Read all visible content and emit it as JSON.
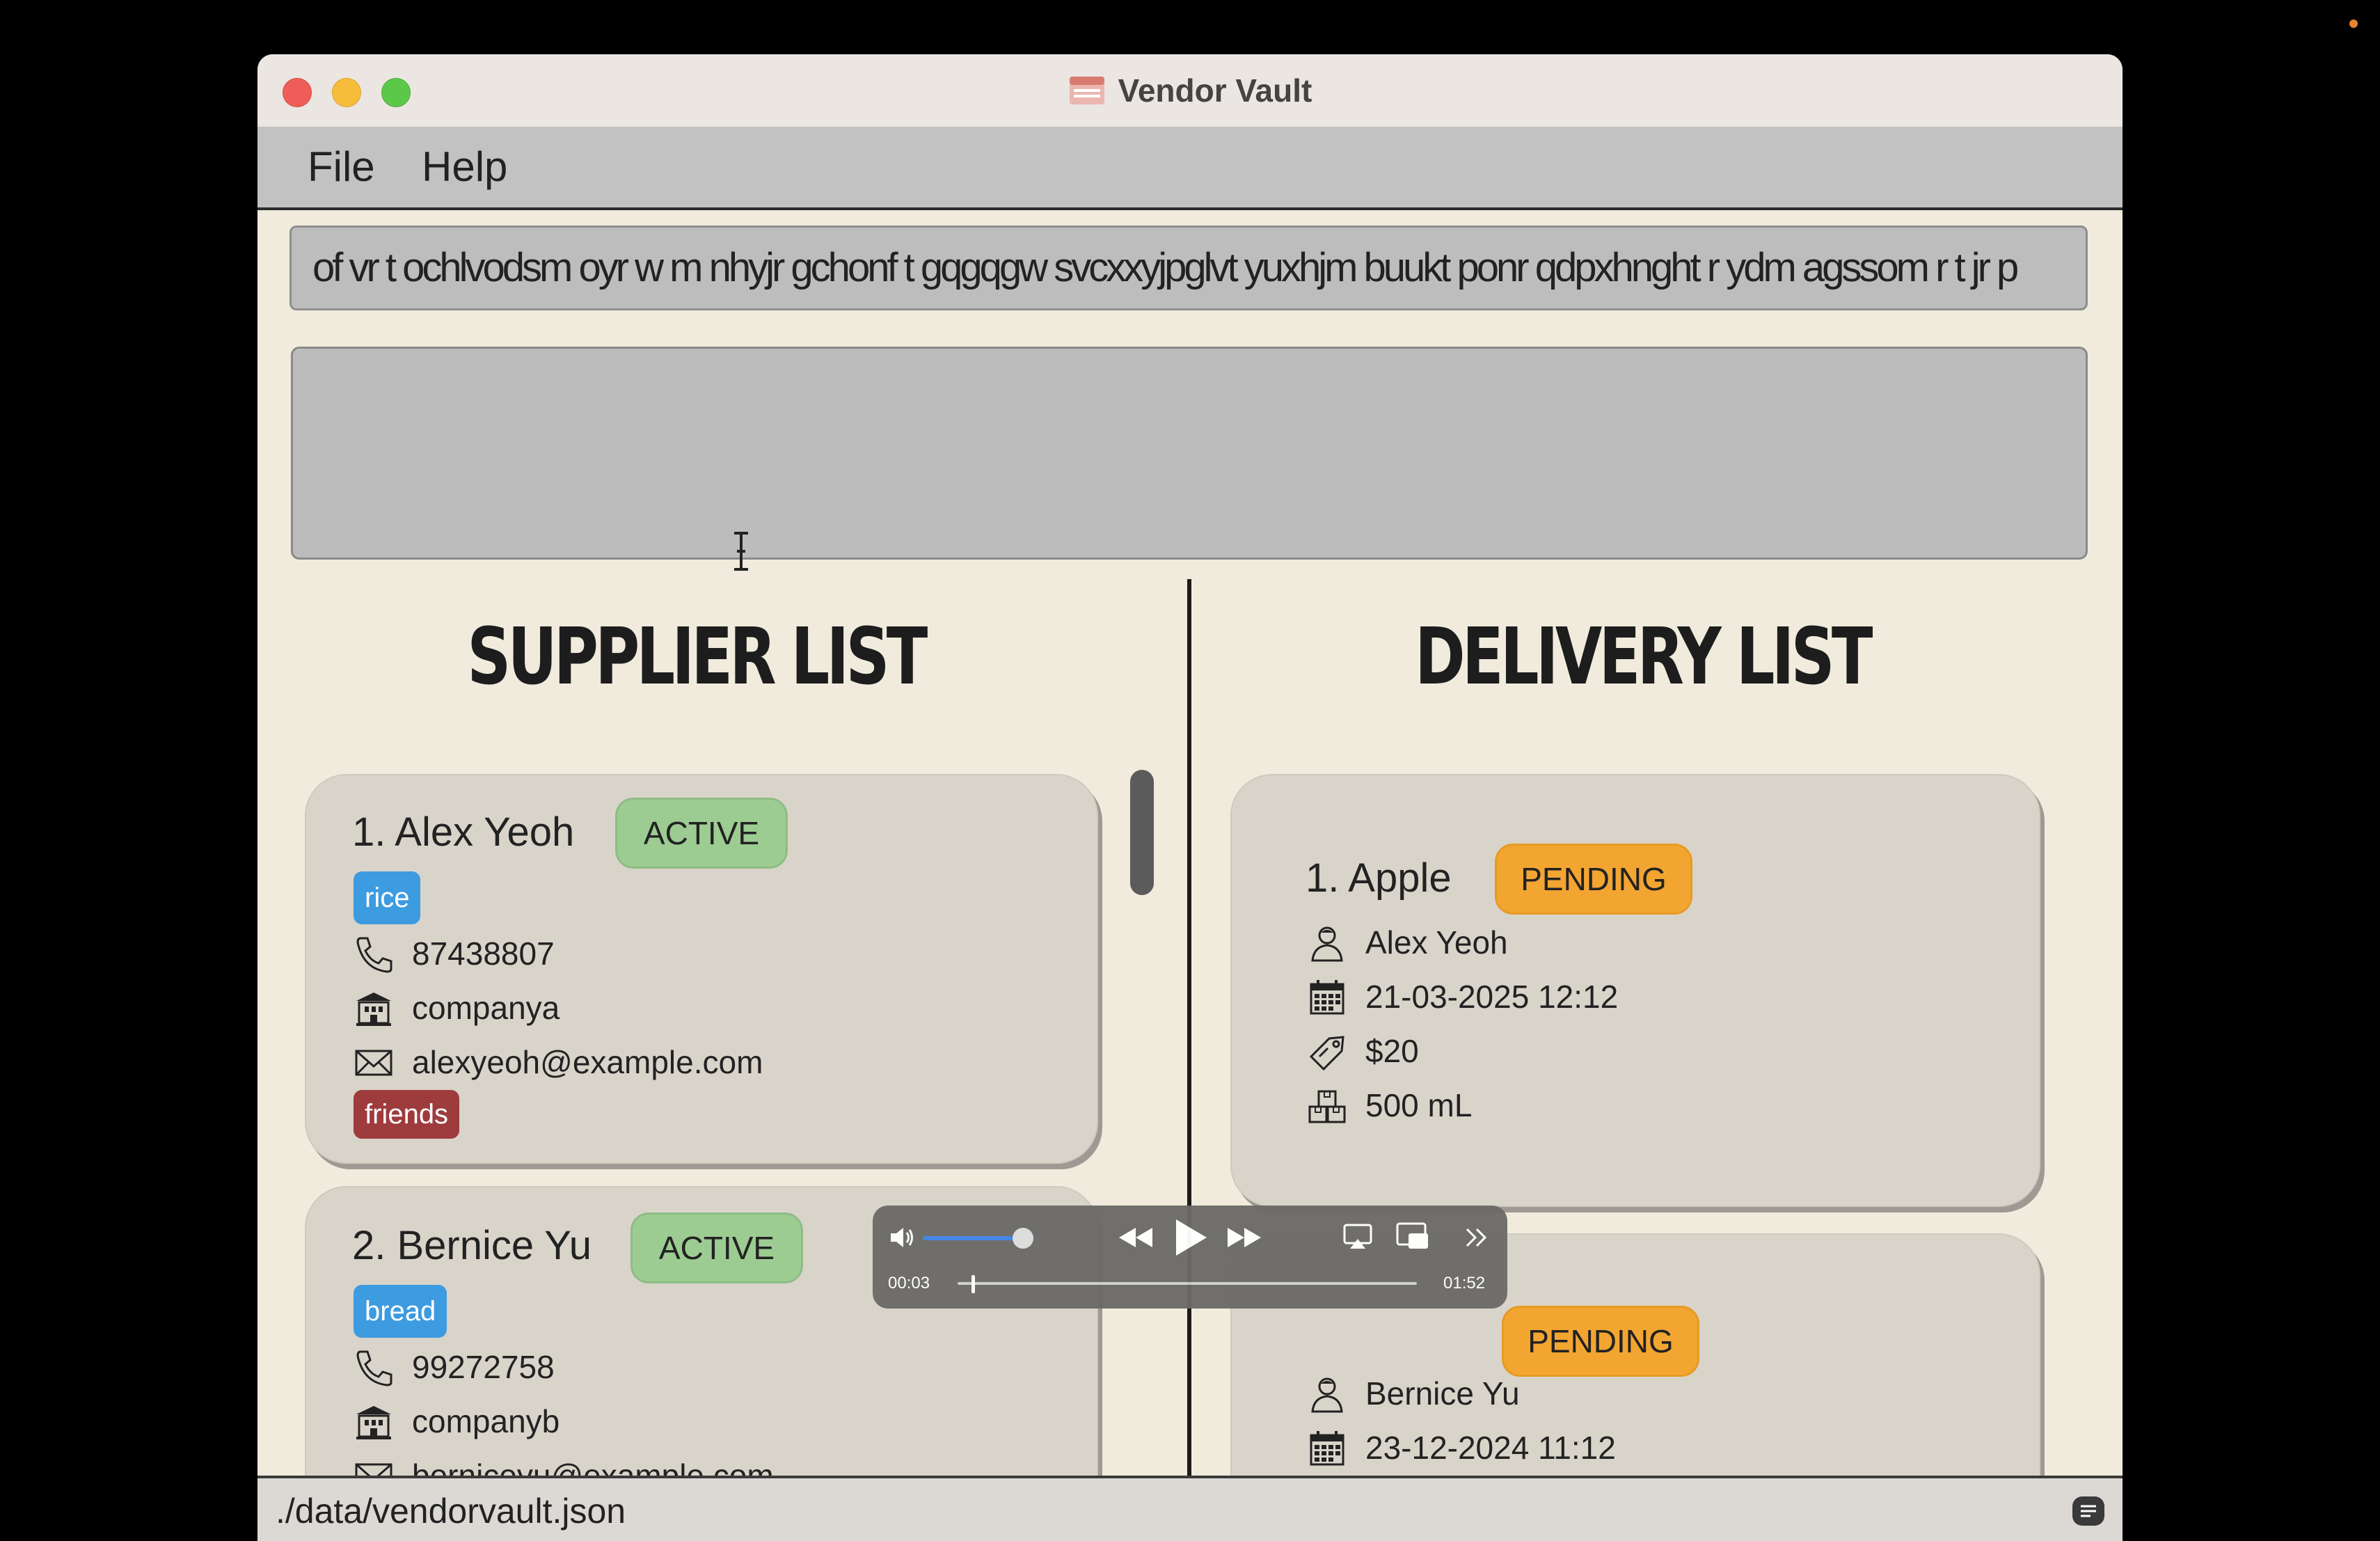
{
  "window": {
    "title": "Vendor Vault",
    "menus": [
      "File",
      "Help"
    ]
  },
  "command_box": {
    "value": "of vr t ochlvodsm oyr w m nhyjr gchonf t gqgqgw svcxxyjpglvt yuxhjm buukt ponr qdpxhnght r ydm agssom r t jr p"
  },
  "result_box": {
    "value": ""
  },
  "suppliers": {
    "heading": "SUPPLIER LIST",
    "items": [
      {
        "index_name": "1. Alex Yeoh",
        "status": "ACTIVE",
        "product_tag": "rice",
        "phone": "87438807",
        "company": "companya",
        "email": "alexyeoh@example.com",
        "tag": "friends"
      },
      {
        "index_name": "2. Bernice Yu",
        "status": "ACTIVE",
        "product_tag": "bread",
        "phone": "99272758",
        "company": "companyb",
        "email": "berniceyu@example.com"
      }
    ]
  },
  "deliveries": {
    "heading": "DELIVERY LIST",
    "items": [
      {
        "index_name": "1. Apple",
        "status": "PENDING",
        "supplier": "Alex Yeoh",
        "datetime": "21-03-2025 12:12",
        "cost": "$20",
        "quantity": "500 mL"
      },
      {
        "status": "PENDING",
        "supplier": "Bernice Yu",
        "datetime": "23-12-2024 11:12"
      }
    ]
  },
  "status_bar": {
    "path": "./data/vendorvault.json"
  },
  "media_player": {
    "elapsed": "00:03",
    "duration": "01:52",
    "volume": 0.8,
    "progress": 0.03
  },
  "icons": {
    "close": "close-icon",
    "minimize": "minimize-icon",
    "zoom": "zoom-icon",
    "phone": "phone-icon",
    "company": "building-icon",
    "email": "envelope-icon",
    "person": "person-icon",
    "calendar": "calendar-icon",
    "cost": "price-tag-icon",
    "quantity": "boxes-icon"
  },
  "colors": {
    "active_badge": "#9ccc92",
    "pending_badge": "#f3a532",
    "product_tag": "#3d9be0",
    "label_tag": "#9e3b3d",
    "window_bg": "#f0ebdc"
  }
}
